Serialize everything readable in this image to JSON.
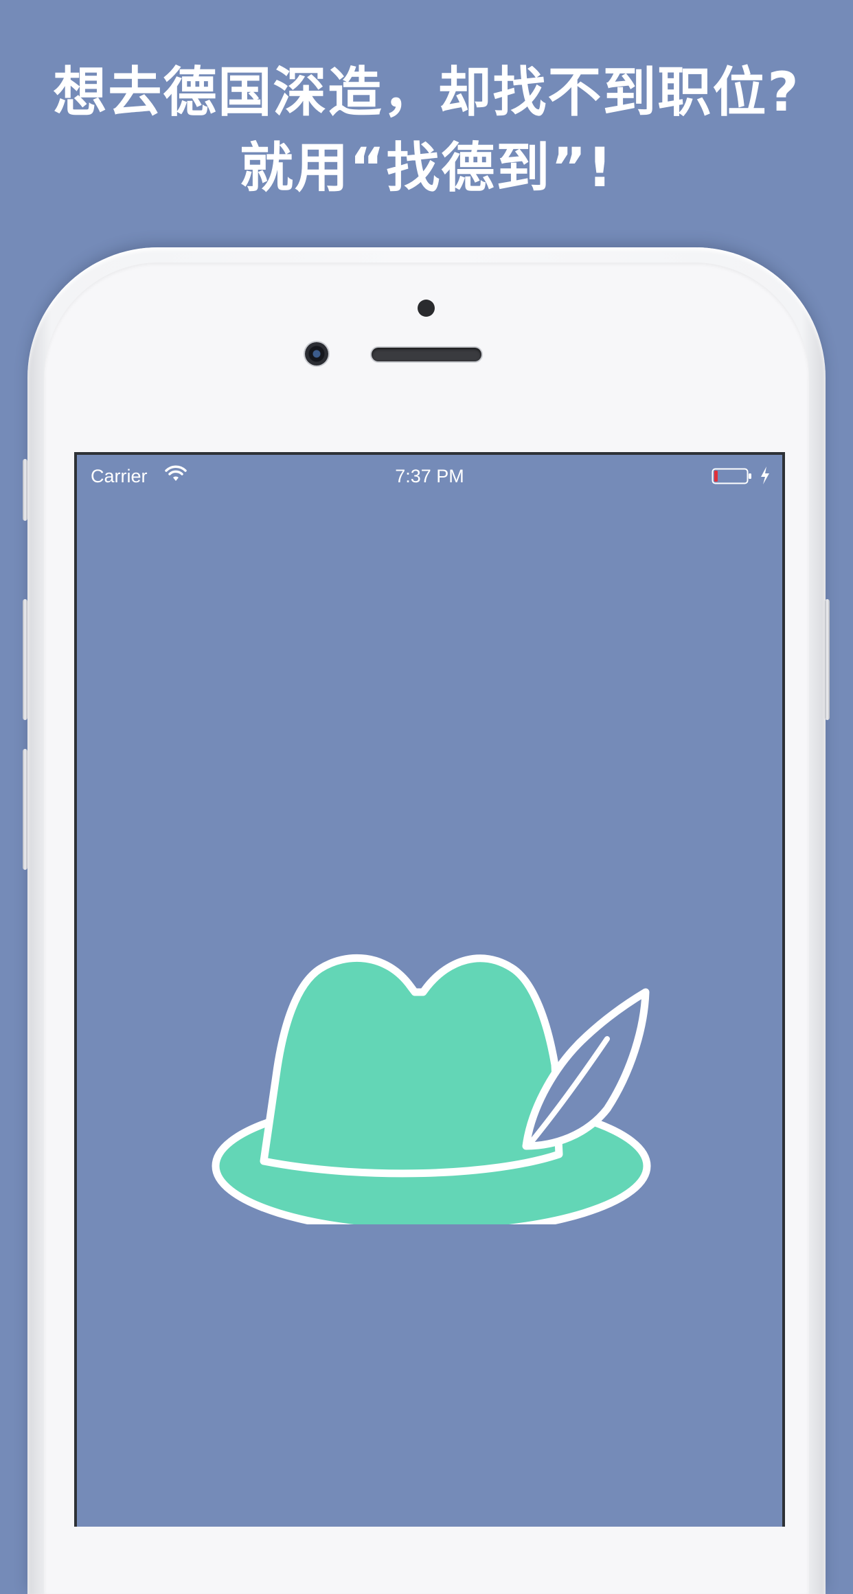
{
  "headline": {
    "line1": "想去德国深造，却找不到职位?",
    "line2": "就用“找德到”!"
  },
  "status_bar": {
    "carrier": "Carrier",
    "time": "7:37 PM",
    "wifi_icon": "wifi-icon",
    "battery_icon": "battery-low-icon",
    "charging_icon": "charging-bolt-icon"
  },
  "app_screen": {
    "logo_icon": "feathered-hat-logo"
  },
  "colors": {
    "background": "#758bb8",
    "hat_fill": "#63d6b6",
    "outline": "#ffffff",
    "battery_low": "#e0303a"
  }
}
